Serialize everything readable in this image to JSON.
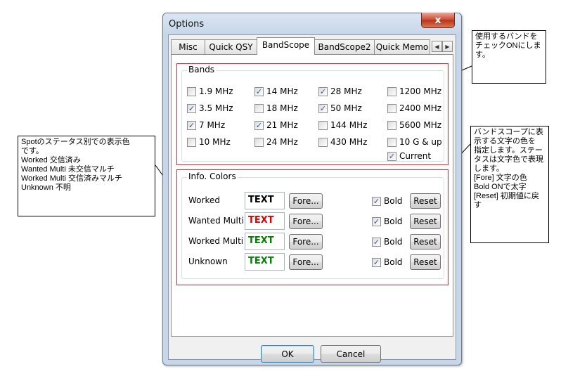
{
  "window": {
    "title": "Options",
    "close_glyph": "x"
  },
  "tabs": [
    {
      "label": "Misc",
      "active": false
    },
    {
      "label": "Quick QSY",
      "active": false
    },
    {
      "label": "BandScope",
      "active": true
    },
    {
      "label": "BandScope2",
      "active": false
    },
    {
      "label": "Quick Memo",
      "active": false
    }
  ],
  "tab_scroll": {
    "left": "◀",
    "right": "▶"
  },
  "bands": {
    "legend": "Bands",
    "items": [
      {
        "label": "1.9 MHz",
        "checked": false
      },
      {
        "label": "14 MHz",
        "checked": true
      },
      {
        "label": "28 MHz",
        "checked": true
      },
      {
        "label": "1200 MHz",
        "checked": false
      },
      {
        "label": "3.5 MHz",
        "checked": true
      },
      {
        "label": "18 MHz",
        "checked": false
      },
      {
        "label": "50 MHz",
        "checked": true
      },
      {
        "label": "2400 MHz",
        "checked": false
      },
      {
        "label": "7 MHz",
        "checked": true
      },
      {
        "label": "21 MHz",
        "checked": true
      },
      {
        "label": "144 MHz",
        "checked": false
      },
      {
        "label": "5600 MHz",
        "checked": false
      },
      {
        "label": "10 MHz",
        "checked": false
      },
      {
        "label": "24 MHz",
        "checked": false
      },
      {
        "label": "430 MHz",
        "checked": false
      },
      {
        "label": "10 G & up",
        "checked": false
      }
    ],
    "current": {
      "label": "Current",
      "checked": true
    }
  },
  "info_colors": {
    "legend": "Info. Colors",
    "fore_label": "Fore...",
    "bold_label": "Bold",
    "reset_label": "Reset",
    "rows": [
      {
        "label": "Worked",
        "sample": "TEXT",
        "color": "#000000",
        "bold": true
      },
      {
        "label": "Wanted Multi",
        "sample": "TEXT",
        "color": "#e00000",
        "bold": true
      },
      {
        "label": "Worked Multi",
        "sample": "TEXT",
        "color": "#008000",
        "bold": true
      },
      {
        "label": "Unknown",
        "sample": "TEXT",
        "color": "#008000",
        "bold": true
      }
    ]
  },
  "buttons": {
    "ok": "OK",
    "cancel": "Cancel"
  },
  "callouts": {
    "bands_note": "使用するバンドを\nチェックONにしま\nす。",
    "status_note": "Spotのステータス別での表示色\nです。\nWorked 交信済み\nWanted Multi 未交信マルチ\nWorked Multi 交信済みマルチ\nUnknown 不明",
    "colors_note": "バンドスコープに表\n示する文字の色を\n指定します。ステー\nタスは文字色で表現\nします。\n[Fore] 文字の色\nBold ONで太字\n[Reset] 初期値に戻\nす"
  },
  "check_glyph": "✓"
}
